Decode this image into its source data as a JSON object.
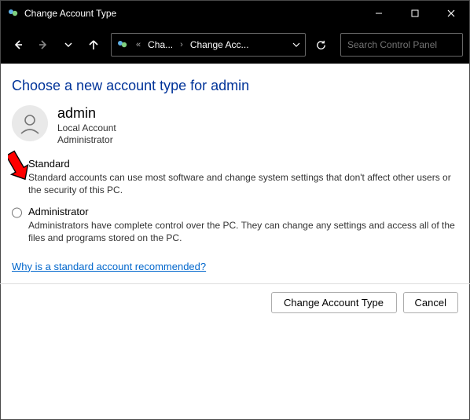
{
  "window": {
    "title": "Change Account Type"
  },
  "toolbar": {
    "breadcrumb1": "Cha...",
    "breadcrumb2": "Change Acc...",
    "search_placeholder": "Search Control Panel"
  },
  "page": {
    "heading": "Choose a new account type for admin"
  },
  "account": {
    "name": "admin",
    "type": "Local Account",
    "role": "Administrator"
  },
  "options": {
    "standard": {
      "label": "Standard",
      "desc": "Standard accounts can use most software and change system settings that don't affect other users or the security of this PC."
    },
    "admin": {
      "label": "Administrator",
      "desc": "Administrators have complete control over the PC. They can change any settings and access all of the files and programs stored on the PC."
    }
  },
  "link": {
    "recommend": "Why is a standard account recommended?"
  },
  "buttons": {
    "change": "Change Account Type",
    "cancel": "Cancel"
  }
}
